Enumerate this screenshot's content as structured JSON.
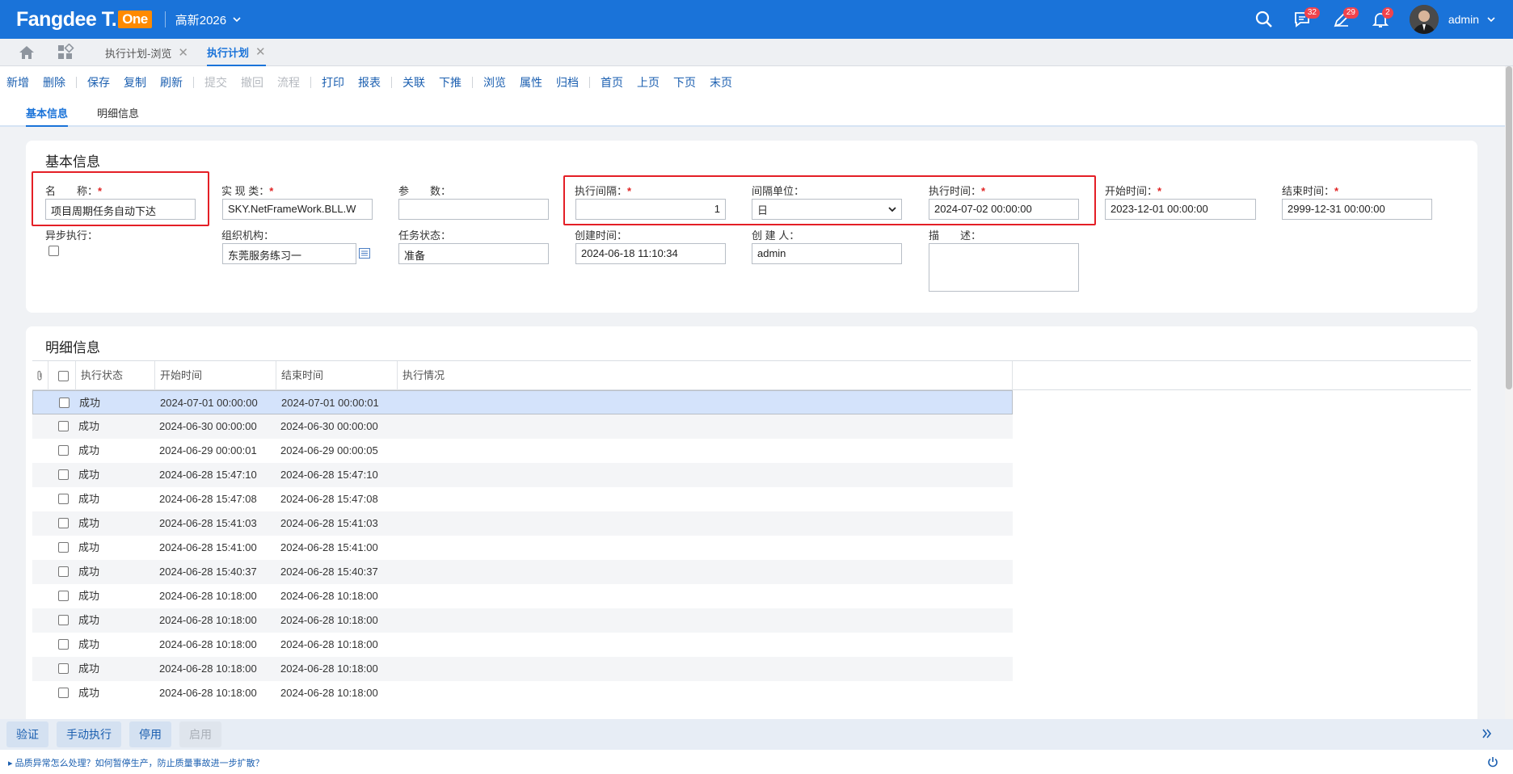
{
  "header": {
    "brand": "Fangdee T.",
    "brand_badge": "One",
    "company": "高新2026",
    "badges": {
      "messages": "32",
      "tasks": "29",
      "notifications": "2"
    },
    "user": "admin"
  },
  "tabs": [
    {
      "label": "执行计划-浏览"
    },
    {
      "label": "执行计划"
    }
  ],
  "toolbar": {
    "add": "新增",
    "delete": "删除",
    "save": "保存",
    "copy": "复制",
    "refresh": "刷新",
    "submit": "提交",
    "revoke": "撤回",
    "flow": "流程",
    "print": "打印",
    "report": "报表",
    "relate": "关联",
    "push": "下推",
    "browse": "浏览",
    "props": "属性",
    "archive": "归档",
    "first": "首页",
    "prev": "上页",
    "next": "下页",
    "last": "末页"
  },
  "subtabs": {
    "basic": "基本信息",
    "detail": "明细信息"
  },
  "basic": {
    "title": "基本信息",
    "name_label": "名　　称：",
    "name_value": "项目周期任务自动下达",
    "impl_label": "实 现 类：",
    "impl_value": "SKY.NetFrameWork.BLL.W",
    "param_label": "参　　数：",
    "param_value": "",
    "interval_label": "执行间隔：",
    "interval_value": "1",
    "unit_label": "间隔单位：",
    "unit_value": "日",
    "exec_time_label": "执行时间：",
    "exec_time_value": "2024-07-02 00:00:00",
    "start_label": "开始时间：",
    "start_value": "2023-12-01 00:00:00",
    "end_label": "结束时间：",
    "end_value": "2999-12-31 00:00:00",
    "async_label": "异步执行：",
    "org_label": "组织机构：",
    "org_value": "东莞服务练习一",
    "status_label": "任务状态：",
    "status_value": "准备",
    "created_label": "创建时间：",
    "created_value": "2024-06-18 11:10:34",
    "creator_label": "创 建 人：",
    "creator_value": "admin",
    "desc_label": "描　　述："
  },
  "detail": {
    "title": "明细信息",
    "columns": {
      "status": "执行状态",
      "start": "开始时间",
      "end": "结束时间",
      "info": "执行情况"
    },
    "rows": [
      {
        "status": "成功",
        "start": "2024-07-01 00:00:00",
        "end": "2024-07-01 00:00:01"
      },
      {
        "status": "成功",
        "start": "2024-06-30 00:00:00",
        "end": "2024-06-30 00:00:00"
      },
      {
        "status": "成功",
        "start": "2024-06-29 00:00:01",
        "end": "2024-06-29 00:00:05"
      },
      {
        "status": "成功",
        "start": "2024-06-28 15:47:10",
        "end": "2024-06-28 15:47:10"
      },
      {
        "status": "成功",
        "start": "2024-06-28 15:47:08",
        "end": "2024-06-28 15:47:08"
      },
      {
        "status": "成功",
        "start": "2024-06-28 15:41:03",
        "end": "2024-06-28 15:41:03"
      },
      {
        "status": "成功",
        "start": "2024-06-28 15:41:00",
        "end": "2024-06-28 15:41:00"
      },
      {
        "status": "成功",
        "start": "2024-06-28 15:40:37",
        "end": "2024-06-28 15:40:37"
      },
      {
        "status": "成功",
        "start": "2024-06-28 10:18:00",
        "end": "2024-06-28 10:18:00"
      },
      {
        "status": "成功",
        "start": "2024-06-28 10:18:00",
        "end": "2024-06-28 10:18:00"
      },
      {
        "status": "成功",
        "start": "2024-06-28 10:18:00",
        "end": "2024-06-28 10:18:00"
      },
      {
        "status": "成功",
        "start": "2024-06-28 10:18:00",
        "end": "2024-06-28 10:18:00"
      },
      {
        "status": "成功",
        "start": "2024-06-28 10:18:00",
        "end": "2024-06-28 10:18:00"
      }
    ]
  },
  "bottom": {
    "verify": "验证",
    "manual": "手动执行",
    "stop": "停用",
    "enable": "启用"
  },
  "status_tip": "品质异常怎么处理？如何暂停生产，防止质量事故进一步扩散？"
}
